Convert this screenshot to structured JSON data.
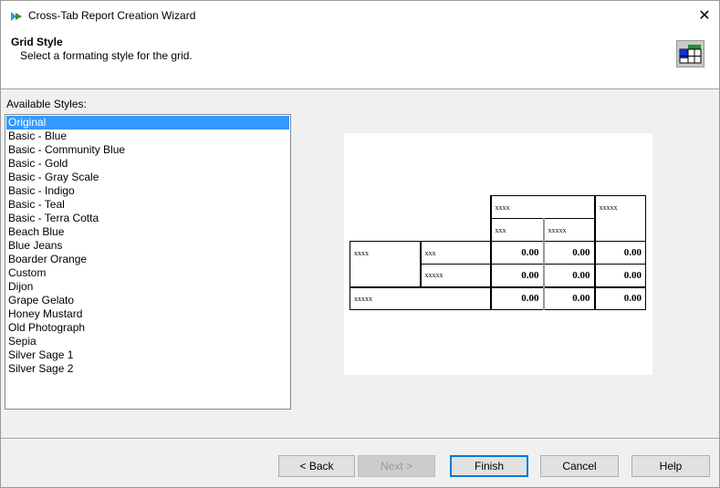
{
  "window": {
    "title": "Cross-Tab Report Creation Wizard",
    "close_glyph": "✕"
  },
  "header": {
    "title": "Grid Style",
    "subtitle": "Select a formating style for the grid.",
    "icon": "grid-style-icon"
  },
  "styles": {
    "label": "Available Styles:",
    "selected": "Original",
    "items": [
      "Original",
      "Basic - Blue",
      "Basic - Community Blue",
      "Basic - Gold",
      "Basic - Gray Scale",
      "Basic - Indigo",
      "Basic - Teal",
      "Basic - Terra Cotta",
      "Beach Blue",
      "Blue Jeans",
      "Boarder Orange",
      "Custom",
      "Dijon",
      "Grape Gelato",
      "Honey Mustard",
      "Old Photograph",
      "Sepia",
      "Silver Sage 1",
      "Silver Sage 2"
    ]
  },
  "preview": {
    "col_group": "xxxx",
    "total_col": "xxxxx",
    "sub_col_1": "xxx",
    "sub_col_2": "xxxxx",
    "row_group": "xxxx",
    "sub_row_1": "xxx",
    "sub_row_2": "xxxxx",
    "total_row": "xxxxx",
    "value": "0.00"
  },
  "buttons": {
    "back": "< Back",
    "next": "Next >",
    "finish": "Finish",
    "cancel": "Cancel",
    "help": "Help"
  },
  "colors": {
    "selection": "#3399ff",
    "default_button_border": "#0078d7"
  }
}
